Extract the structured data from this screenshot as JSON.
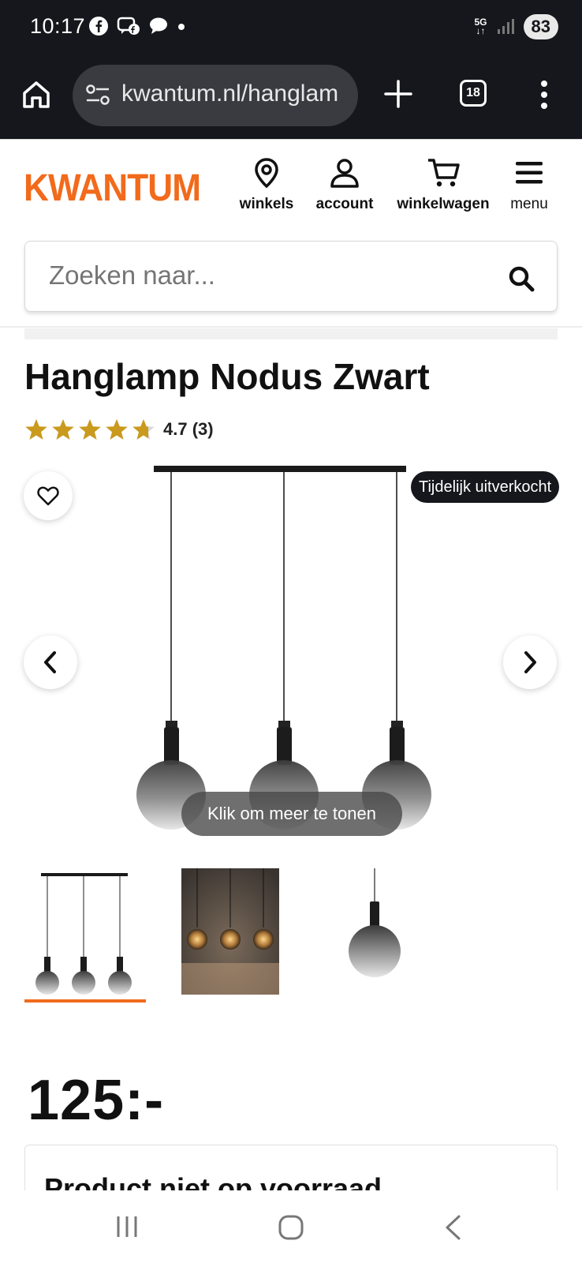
{
  "status_bar": {
    "time": "10:17",
    "network": "5G",
    "battery": "83"
  },
  "browser": {
    "url": "kwantum.nl/hanglam",
    "tab_count": "18"
  },
  "header": {
    "logo": "KWANTUM",
    "nav": [
      {
        "label": "winkels",
        "icon": "location-pin-icon"
      },
      {
        "label": "account",
        "icon": "user-icon"
      },
      {
        "label": "winkelwagen",
        "icon": "cart-icon"
      },
      {
        "label": "menu",
        "icon": "hamburger-icon"
      }
    ]
  },
  "search": {
    "placeholder": "Zoeken naar..."
  },
  "product": {
    "title": "Hanglamp Nodus Zwart",
    "rating_value": 4.7,
    "rating_text": "4.7 (3)",
    "stars_max": 5,
    "badge": "Tijdelijk uitverkocht",
    "show_more": "Klik om meer te tonen",
    "price": "125:-",
    "stock_title": "Product niet op voorraad"
  },
  "colors": {
    "brand": "#f26a1b",
    "star": "#c99a1d",
    "dark": "#16171c"
  }
}
